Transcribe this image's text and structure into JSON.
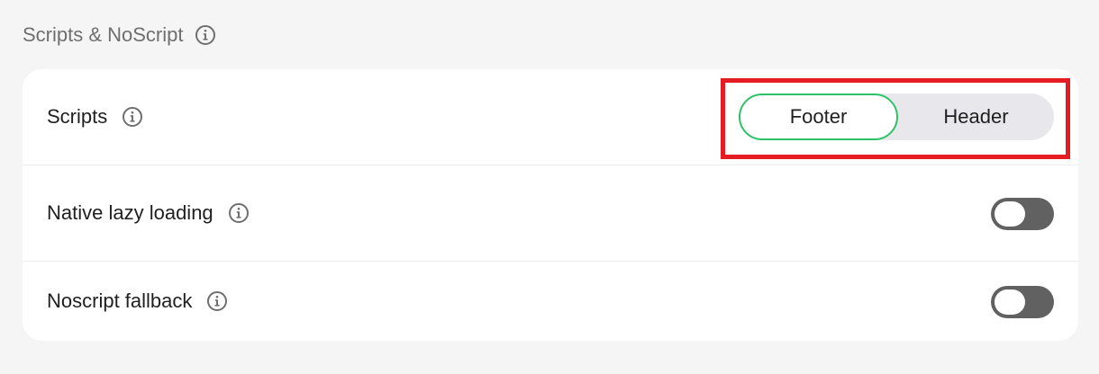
{
  "section": {
    "title": "Scripts & NoScript",
    "info_icon": "info-icon"
  },
  "settings": {
    "scripts": {
      "label": "Scripts",
      "options": [
        "Footer",
        "Header"
      ],
      "selected": "Footer",
      "accent_color": "#2ec266",
      "highlight_color": "#e51c23"
    },
    "lazy_loading": {
      "label": "Native lazy loading",
      "enabled": false
    },
    "noscript": {
      "label": "Noscript fallback",
      "enabled": false
    }
  }
}
